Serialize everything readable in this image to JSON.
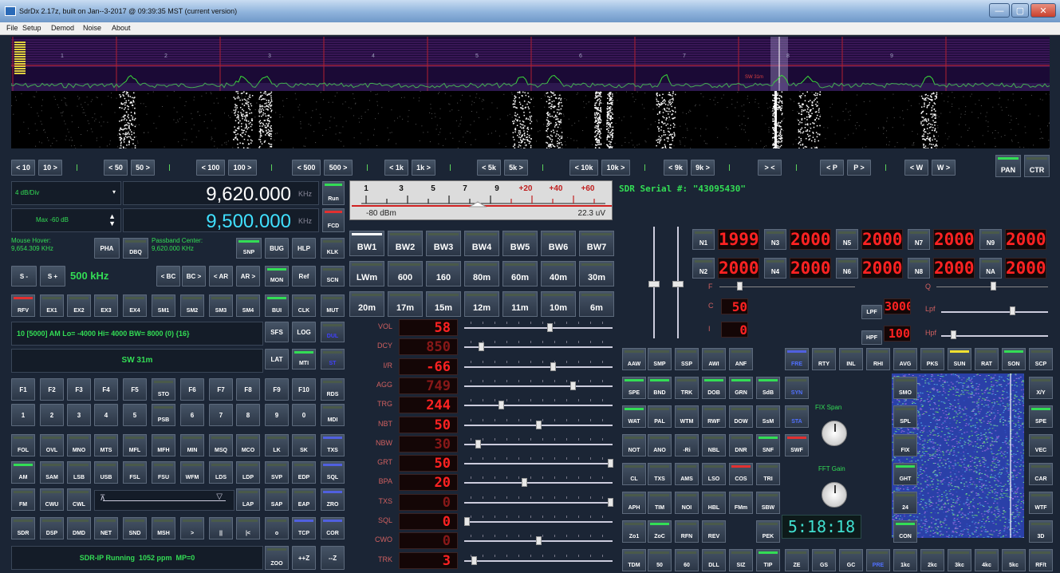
{
  "window": {
    "title": "SdrDx 2.17z, built on Jan--3-2017 @ 09:39:35 MST (current version)",
    "minimize": "—",
    "maximize": "▢",
    "close": "✕"
  },
  "menu": [
    "File",
    "Setup",
    "Demod",
    "Noise",
    "About"
  ],
  "spectrum": {
    "scale_marks": [
      "1",
      "2",
      "3",
      "4",
      "5",
      "6",
      "7",
      "8",
      "9"
    ],
    "station_label": "SW 31m"
  },
  "tuning": [
    "< 10",
    "10 >",
    "< 50",
    "50 >",
    "< 100",
    "100 >",
    "< 500",
    "500 >",
    "< 1k",
    "1k >",
    "< 5k",
    "5k >",
    "< 10k",
    "10k >",
    "< 9k",
    "9k >",
    "> <",
    "< P",
    "P >",
    "< W",
    "W >"
  ],
  "top_right": {
    "pan": "PAN",
    "ctr": "CTR"
  },
  "left": {
    "div_select": "4 dB/Div",
    "max_select": "Max -60 dB",
    "freq1": "9,620.000",
    "freq1_unit": "KHz",
    "freq2": "9,500.000",
    "freq2_unit": "KHz",
    "run": "Run",
    "fcd": "FCD",
    "mouse_hover_label": "Mouse Hover:",
    "mouse_hover_value": "9,654.309 KHz",
    "passband_label": "Passband Center:",
    "passband_value": "9,620.000 KHz",
    "pha": "PHA",
    "dbq": "DBQ",
    "snp": "SNP",
    "bug": "BUG",
    "hlp": "HLP",
    "klk": "KLK",
    "step_minus": "S -",
    "step_plus": "S +",
    "step_value": "500 kHz",
    "bc_prev": "< BC",
    "bc_next": "BC >",
    "ar_prev": "< AR",
    "ar_next": "AR >",
    "mon": "MON",
    "ref": "Ref",
    "scn": "SCN",
    "row_ex": [
      "RFV",
      "EX1",
      "EX2",
      "EX3",
      "EX4",
      "SM1",
      "SM2",
      "SM3",
      "SM4",
      "BUI",
      "CLK",
      "MUT"
    ],
    "info_line": "10 [5000] AM Lo= -4000 Hi= 4000 BW= 8000 (0) {16}",
    "sfs": "SFS",
    "log": "LOG",
    "dul": "DUL",
    "band_name": "SW 31m",
    "lat": "LAT",
    "mti": "MTI",
    "st": "ST",
    "row_f": [
      "F1",
      "F2",
      "F3",
      "F4",
      "F5",
      "STO",
      "F6",
      "F7",
      "F8",
      "F9",
      "F10",
      "RDS"
    ],
    "row_num": [
      "1",
      "2",
      "3",
      "4",
      "5",
      "PSB",
      "6",
      "7",
      "8",
      "9",
      "0",
      "MDI"
    ],
    "row_fol": [
      "FOL",
      "OVL",
      "MNO",
      "MTS",
      "MFL",
      "MFH",
      "MIN",
      "MSQ",
      "MCO",
      "LK",
      "SK",
      "TXS"
    ],
    "row_am": [
      "AM",
      "SAM",
      "LSB",
      "USB",
      "FSL",
      "FSU",
      "WFM",
      "LDS",
      "LDP",
      "SVP",
      "EDP",
      "SQL"
    ],
    "row_fm": [
      "FM",
      "CWU",
      "CWL",
      "LAP",
      "SAP",
      "EAP",
      "ZRO"
    ],
    "row_sdr": [
      "SDR",
      "DSP",
      "DMD",
      "NET",
      "SND",
      "MSH",
      ">",
      "||",
      "|<",
      "o",
      "TCP",
      "COR"
    ],
    "status": "SDR-IP Running  1052 ppm  MP=0",
    "zoo": "ZOO",
    "ppz": "++Z",
    "mz": "--Z"
  },
  "smeter": {
    "scale": [
      "1",
      "3",
      "5",
      "7",
      "9",
      "+20",
      "+40",
      "+60"
    ],
    "dbm": "-80 dBm",
    "uv": "22.3 uV"
  },
  "serial": "SDR Serial #: \"43095430\"",
  "bw": [
    "BW1",
    "BW2",
    "BW3",
    "BW4",
    "BW5",
    "BW6",
    "BW7"
  ],
  "bands1": [
    "LWm",
    "600",
    "160",
    "80m",
    "60m",
    "40m",
    "30m"
  ],
  "bands2": [
    "20m",
    "17m",
    "15m",
    "12m",
    "11m",
    "10m",
    "6m"
  ],
  "params": [
    {
      "name": "VOL",
      "value": "58",
      "pos": 0.58
    },
    {
      "name": "DCY",
      "value": "850",
      "pos": 0.1,
      "dim": true
    },
    {
      "name": "I/R",
      "value": "-66",
      "pos": 0.6
    },
    {
      "name": "AGG",
      "value": "749",
      "pos": 0.74,
      "dim": true
    },
    {
      "name": "TRG",
      "value": "244",
      "pos": 0.24
    },
    {
      "name": "NBT",
      "value": "50",
      "pos": 0.5
    },
    {
      "name": "NBW",
      "value": "30",
      "pos": 0.08,
      "dim": true
    },
    {
      "name": "GRT",
      "value": "50",
      "pos": 1.0
    },
    {
      "name": "BPA",
      "value": "20",
      "pos": 0.4
    },
    {
      "name": "TXS",
      "value": "0",
      "pos": 1.0,
      "dim": true
    },
    {
      "name": "SQL",
      "value": "0",
      "pos": 0.0
    },
    {
      "name": "CWO",
      "value": "0",
      "pos": 0.5,
      "dim": true
    },
    {
      "name": "TRK",
      "value": "3",
      "pos": 0.05
    }
  ],
  "notch": [
    {
      "id": "N1",
      "value": "1999"
    },
    {
      "id": "N3",
      "value": "2000"
    },
    {
      "id": "N5",
      "value": "2000"
    },
    {
      "id": "N7",
      "value": "2000"
    },
    {
      "id": "N9",
      "value": "2000"
    },
    {
      "id": "N2",
      "value": "2000"
    },
    {
      "id": "N4",
      "value": "2000"
    },
    {
      "id": "N6",
      "value": "2000"
    },
    {
      "id": "N8",
      "value": "2000"
    },
    {
      "id": "NA",
      "value": "2000"
    }
  ],
  "filter": {
    "f_label": "F",
    "c_label": "C",
    "c_value": "50",
    "i_label": "I",
    "i_value": "0",
    "q_label": "Q",
    "lpf": "LPF",
    "lpf_value": "3000",
    "hpf": "HPF",
    "hpf_value": "100",
    "lpf_slider": "Lpf",
    "hpf_slider": "Hpf"
  },
  "grid": [
    [
      "AAW",
      "SMP",
      "SSP",
      "AWI",
      "ANF",
      "",
      "FRE",
      "RTY",
      "INL",
      "RHI",
      "AVG",
      "PKS",
      "SUN",
      "RAT",
      "SON",
      "SCP"
    ],
    [
      "SPE",
      "BND",
      "TRK",
      "DOB",
      "GRN",
      "SdB",
      "SYN",
      "",
      "",
      "",
      "SMO",
      "",
      "",
      "",
      "",
      "X/Y"
    ],
    [
      "WAT",
      "PAL",
      "WTM",
      "RWF",
      "DOW",
      "SsM",
      "STA",
      "",
      "",
      "",
      "SPL",
      "",
      "",
      "",
      "",
      "SPE"
    ],
    [
      "NOT",
      "ANO",
      "-Ri",
      "NBL",
      "DNR",
      "SNF",
      "SWF",
      "",
      "",
      "",
      "FIX",
      "",
      "",
      "",
      "",
      "VEC"
    ],
    [
      "CL",
      "TXS",
      "AMS",
      "LSO",
      "COS",
      "TRI",
      "",
      "",
      "",
      "",
      "GHT",
      "",
      "",
      "",
      "",
      "CAR"
    ],
    [
      "APH",
      "TIM",
      "NOI",
      "HBL",
      "FMm",
      "SBW",
      "",
      "",
      "",
      "",
      "24",
      "",
      "",
      "",
      "",
      "WTF"
    ],
    [
      "Zo1",
      "ZoC",
      "RFN",
      "REV",
      "",
      "PEK",
      "",
      "",
      "",
      "",
      "CON",
      "",
      "",
      "",
      "",
      "3D"
    ],
    [
      "TDM",
      "50",
      "60",
      "DLL",
      "SIZ",
      "TIP",
      "ZE",
      "GS",
      "GC",
      "PRE",
      "1kc",
      "2kc",
      "3kc",
      "4kc",
      "5kc",
      "RF/t"
    ]
  ],
  "knobs": {
    "fix_span": "FIX Span",
    "fft_gain": "FFT Gain"
  },
  "clock": "5:18:18"
}
